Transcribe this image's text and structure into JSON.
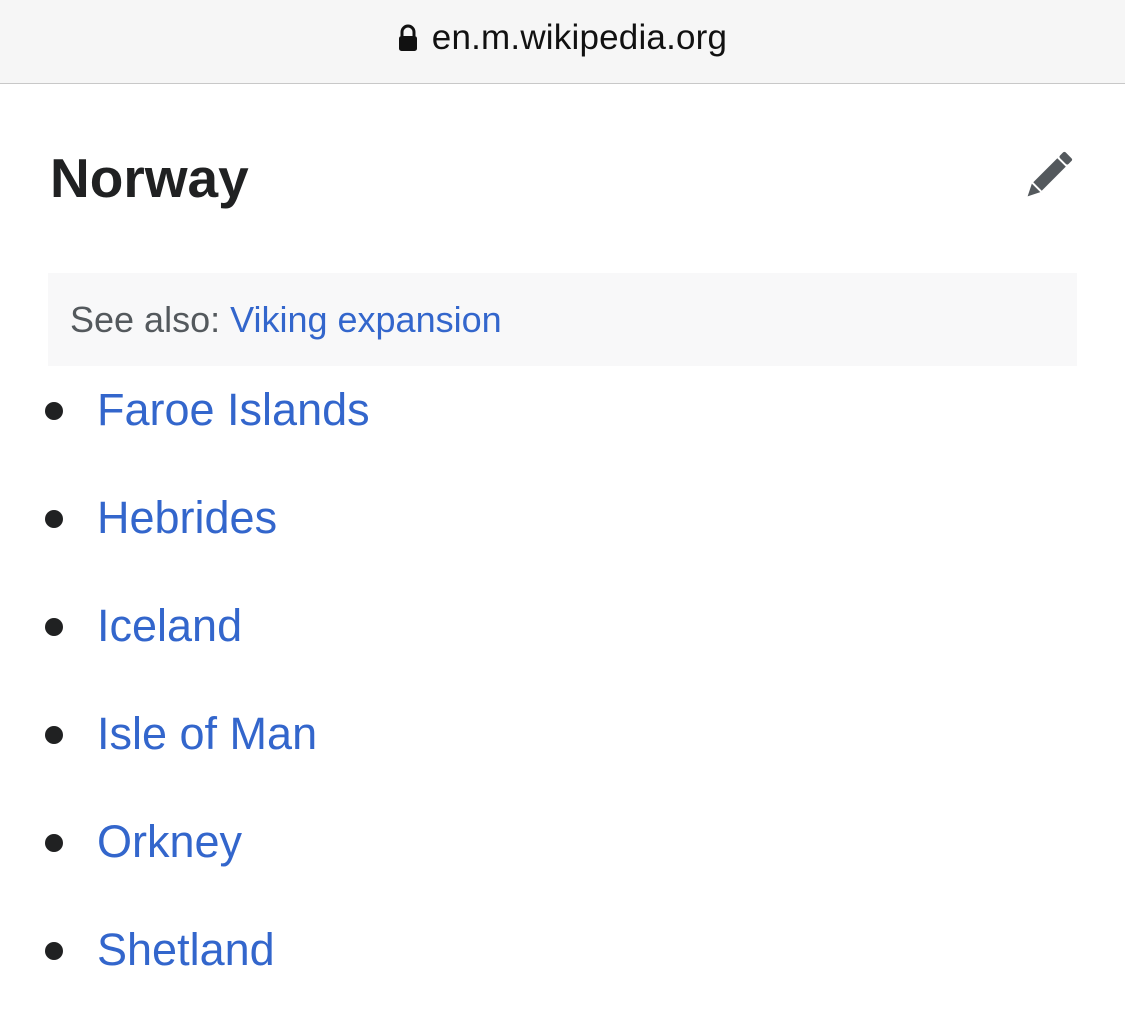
{
  "browser": {
    "url": "en.m.wikipedia.org",
    "lock_icon": "lock-icon"
  },
  "section": {
    "title": "Norway",
    "edit_icon": "pencil-icon"
  },
  "hatnote": {
    "prefix": "See also:",
    "link_label": "Viking expansion"
  },
  "list": {
    "items": [
      {
        "label": "Faroe Islands"
      },
      {
        "label": "Hebrides"
      },
      {
        "label": "Iceland"
      },
      {
        "label": "Isle of Man"
      },
      {
        "label": "Orkney"
      },
      {
        "label": "Shetland"
      }
    ]
  },
  "colors": {
    "link": "#3366cc",
    "text": "#202122",
    "hatnote_bg": "#f8f8f9",
    "urlbar_bg": "#f6f6f6"
  }
}
